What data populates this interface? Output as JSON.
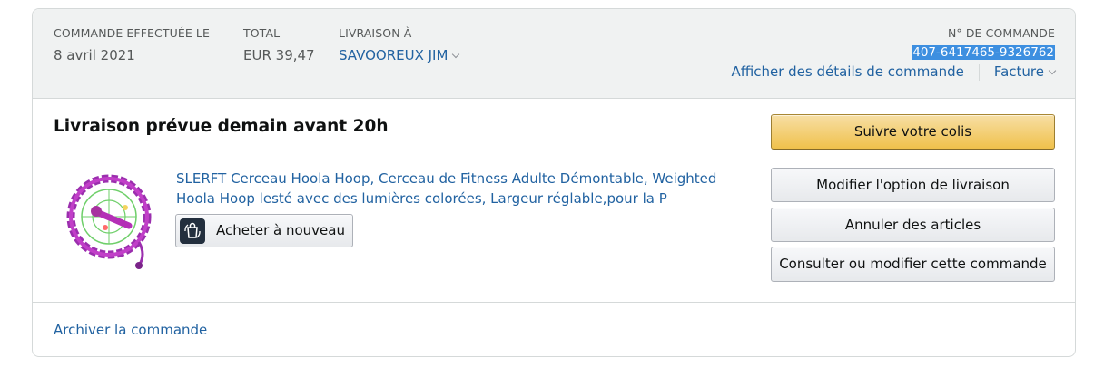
{
  "header": {
    "order_date_label": "COMMANDE EFFECTUÉE LE",
    "order_date": "8 avril 2021",
    "total_label": "TOTAL",
    "total": "EUR 39,47",
    "ship_to_label": "LIVRAISON À",
    "ship_to": "SAVOOREUX JIM",
    "order_number_label": "N° DE COMMANDE",
    "order_number": "407-6417465-9326762",
    "details_link": "Afficher des détails de commande",
    "invoice_link": "Facture"
  },
  "shipment": {
    "status": "Livraison prévue demain avant 20h",
    "product_title": "SLERFT Cerceau Hoola Hoop, Cerceau de Fitness Adulte Démontable, Weighted Hoola Hoop lesté avec des lumières colorées, Largeur réglable,pour la P",
    "buy_again_label": "Acheter à nouveau"
  },
  "actions": {
    "track": "Suivre votre colis",
    "change_delivery": "Modifier l'option de livraison",
    "cancel_items": "Annuler des articles",
    "view_edit_order": "Consulter ou modifier cette commande"
  },
  "footer": {
    "archive": "Archiver la commande"
  },
  "colors": {
    "link": "#2162a1",
    "header_bg": "#f0f2f2",
    "primary_button": "#f0c14b",
    "selection_highlight": "#3d8fe0"
  }
}
